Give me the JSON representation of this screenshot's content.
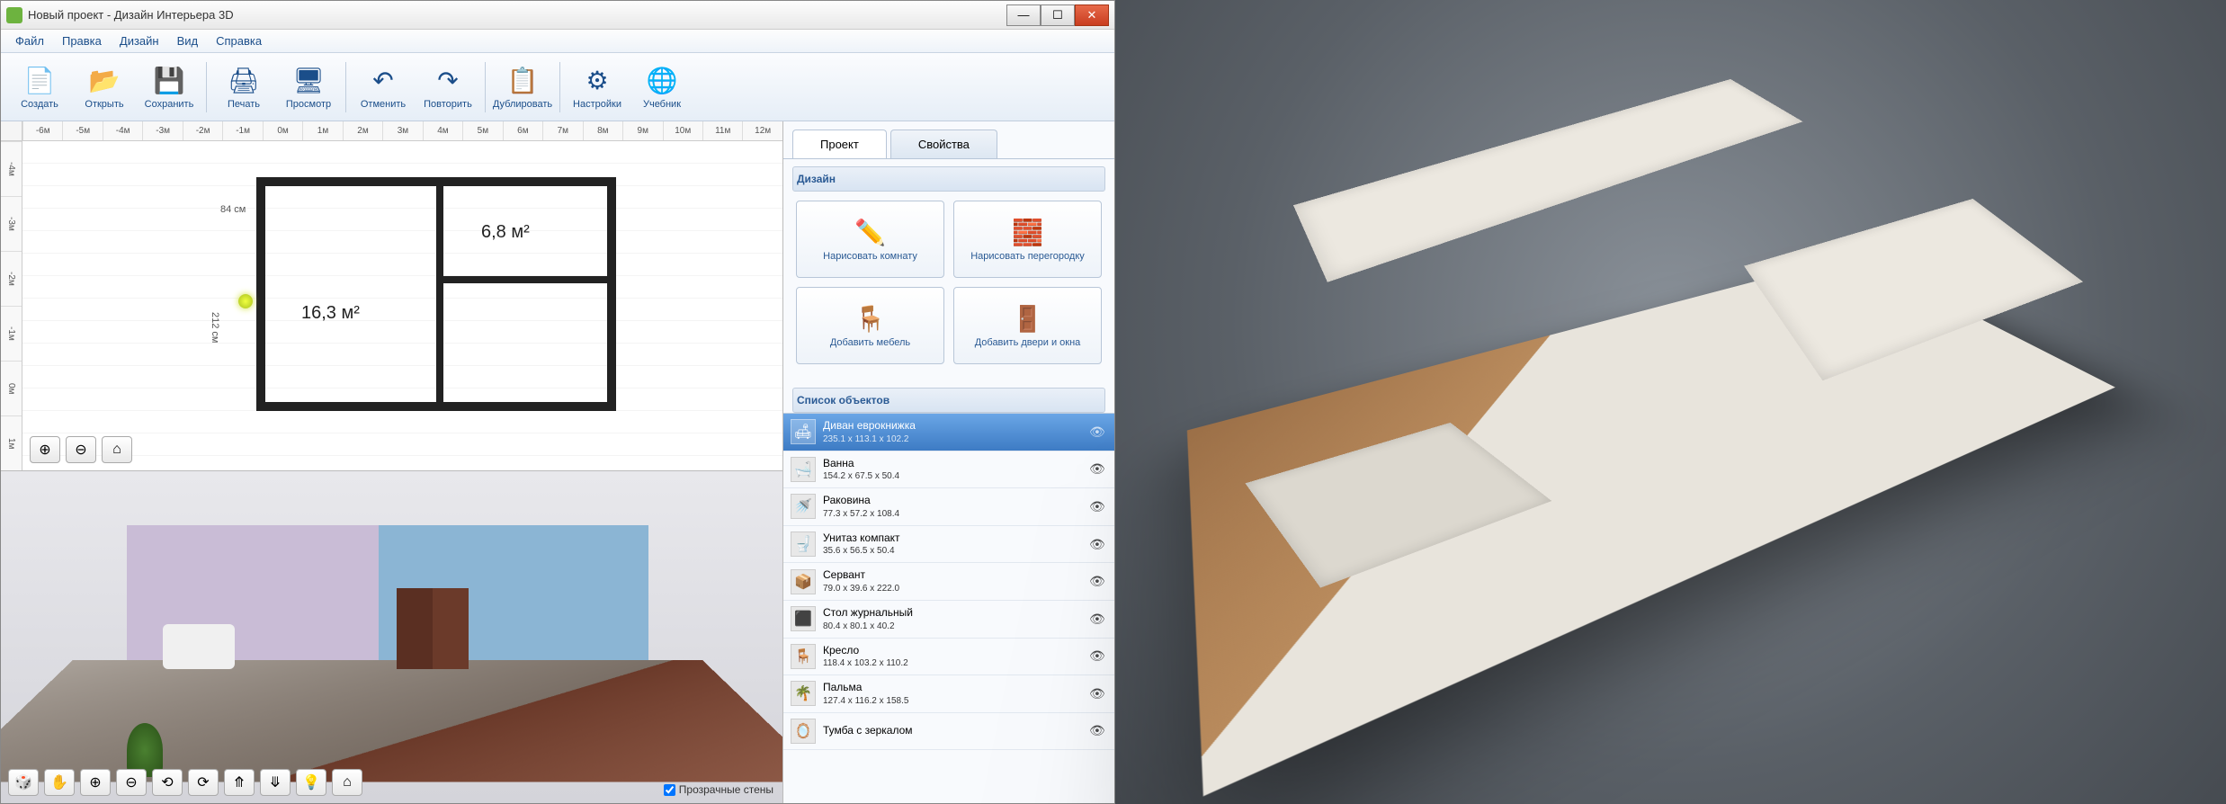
{
  "window": {
    "title": "Новый проект - Дизайн Интерьера 3D"
  },
  "menu": {
    "items": [
      "Файл",
      "Правка",
      "Дизайн",
      "Вид",
      "Справка"
    ]
  },
  "toolbar": {
    "groups": [
      [
        {
          "icon": "📄",
          "label": "Создать",
          "name": "new-button"
        },
        {
          "icon": "📂",
          "label": "Открыть",
          "name": "open-button"
        },
        {
          "icon": "💾",
          "label": "Сохранить",
          "name": "save-button"
        }
      ],
      [
        {
          "icon": "🖨",
          "label": "Печать",
          "name": "print-button"
        },
        {
          "icon": "🖥",
          "label": "Просмотр",
          "name": "preview-button"
        }
      ],
      [
        {
          "icon": "↶",
          "label": "Отменить",
          "name": "undo-button"
        },
        {
          "icon": "↷",
          "label": "Повторить",
          "name": "redo-button"
        }
      ],
      [
        {
          "icon": "📋",
          "label": "Дублировать",
          "name": "duplicate-button"
        }
      ],
      [
        {
          "icon": "⚙",
          "label": "Настройки",
          "name": "settings-button"
        },
        {
          "icon": "🌐",
          "label": "Учебник",
          "name": "tutorial-button"
        }
      ]
    ]
  },
  "ruler": {
    "h": [
      "-6м",
      "-5м",
      "-4м",
      "-3м",
      "-2м",
      "-1м",
      "0м",
      "1м",
      "2м",
      "3м",
      "4м",
      "5м",
      "6м",
      "7м",
      "8м",
      "9м",
      "10м",
      "11м",
      "12м"
    ],
    "v": [
      "-4м",
      "-3м",
      "-2м",
      "-1м",
      "0м",
      "1м"
    ]
  },
  "plan": {
    "room1_area": "16,3 м²",
    "room2_area": "6,8 м²",
    "dim1": "84 см",
    "dim2": "212 см"
  },
  "tabs": {
    "project": "Проект",
    "properties": "Свойства"
  },
  "design_section": {
    "title": "Дизайн",
    "buttons": [
      {
        "icon": "✏️",
        "label": "Нарисовать комнату",
        "name": "draw-room-button"
      },
      {
        "icon": "🧱",
        "label": "Нарисовать перегородку",
        "name": "draw-partition-button"
      },
      {
        "icon": "🪑",
        "label": "Добавить мебель",
        "name": "add-furniture-button"
      },
      {
        "icon": "🚪",
        "label": "Добавить двери и окна",
        "name": "add-doors-button"
      }
    ]
  },
  "objects_section": {
    "title": "Список объектов",
    "items": [
      {
        "name": "Диван еврокнижка",
        "dims": "235.1 x 113.1 x 102.2",
        "icon": "🛋",
        "selected": true
      },
      {
        "name": "Ванна",
        "dims": "154.2 x 67.5 x 50.4",
        "icon": "🛁"
      },
      {
        "name": "Раковина",
        "dims": "77.3 x 57.2 x 108.4",
        "icon": "🚿"
      },
      {
        "name": "Унитаз компакт",
        "dims": "35.6 x 56.5 x 50.4",
        "icon": "🚽"
      },
      {
        "name": "Сервант",
        "dims": "79.0 x 39.6 x 222.0",
        "icon": "📦"
      },
      {
        "name": "Стол журнальный",
        "dims": "80.4 x 80.1 x 40.2",
        "icon": "⬛"
      },
      {
        "name": "Кресло",
        "dims": "118.4 x 103.2 x 110.2",
        "icon": "🪑"
      },
      {
        "name": "Пальма",
        "dims": "127.4 x 116.2 x 158.5",
        "icon": "🌴"
      },
      {
        "name": "Тумба с зеркалом",
        "dims": "",
        "icon": "🪞"
      }
    ]
  },
  "transparent_walls": "Прозрачные стены"
}
